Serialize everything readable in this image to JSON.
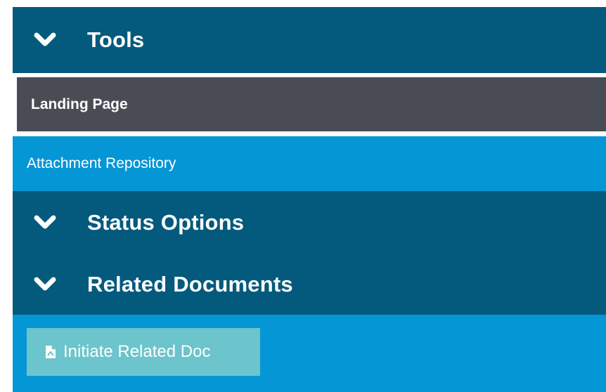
{
  "sections": {
    "tools": {
      "label": "Tools",
      "icon": "chevron-down-icon"
    },
    "status_options": {
      "label": "Status Options",
      "icon": "chevron-down-icon"
    },
    "related_documents": {
      "label": "Related Documents",
      "icon": "chevron-down-icon"
    }
  },
  "tools_items": {
    "landing_page": "Landing Page",
    "attachment_repository": "Attachment Repository"
  },
  "actions": {
    "initiate_related_doc": {
      "label": "Initiate Related Doc",
      "icon": "document-icon"
    }
  },
  "colors": {
    "header_bg": "#045a7d",
    "landing_bg": "#4a4c55",
    "highlight_bg": "#0596d6",
    "button_bg": "#6cc4cc"
  }
}
